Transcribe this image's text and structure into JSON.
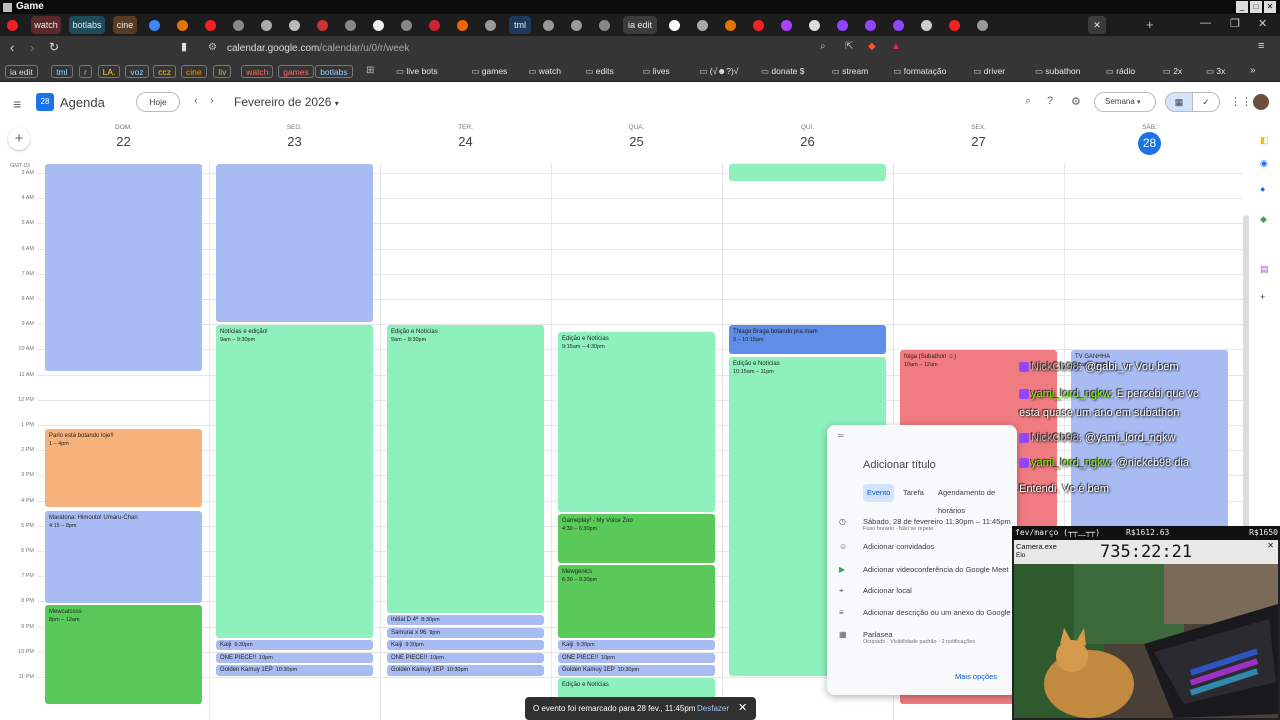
{
  "window": {
    "title": "Game"
  },
  "tabs": [
    {
      "type": "icon",
      "icon": "youtube-icon",
      "color": "#e22"
    },
    {
      "type": "label",
      "label": "watch",
      "bg": "#5a2a2a"
    },
    {
      "type": "label",
      "label": "botlabs",
      "bg": "#1e4c5a"
    },
    {
      "type": "label",
      "label": "cine",
      "bg": "#5a3a20"
    },
    {
      "type": "icon",
      "icon": "google-icon",
      "color": "#4285f4"
    },
    {
      "type": "icon",
      "icon": "extension-icon",
      "color": "#e37400"
    },
    {
      "type": "icon",
      "icon": "record-icon",
      "color": "#e22"
    },
    {
      "type": "icon",
      "icon": "page-icon",
      "color": "#888"
    },
    {
      "type": "icon",
      "icon": "globe-icon",
      "color": "#aaa"
    },
    {
      "type": "icon",
      "icon": "info-icon",
      "color": "#bbb"
    },
    {
      "type": "icon",
      "icon": "site-icon",
      "color": "#c33"
    },
    {
      "type": "icon",
      "icon": "site-icon",
      "color": "#888"
    },
    {
      "type": "icon",
      "icon": "site-icon",
      "color": "#eee"
    },
    {
      "type": "icon",
      "icon": "play-icon",
      "color": "#888"
    },
    {
      "type": "icon",
      "icon": "site-icon",
      "color": "#c23"
    },
    {
      "type": "icon",
      "icon": "site-icon",
      "color": "#e60"
    },
    {
      "type": "icon",
      "icon": "shield-icon",
      "color": "#999"
    },
    {
      "type": "label",
      "label": "tml",
      "bg": "#1e3a5a"
    },
    {
      "type": "icon",
      "icon": "shield-icon",
      "color": "#999"
    },
    {
      "type": "icon",
      "icon": "shield-icon",
      "color": "#999"
    },
    {
      "type": "icon",
      "icon": "site-icon",
      "color": "#888"
    },
    {
      "type": "label",
      "label": "ia edit",
      "bg": "#3c3c3c"
    },
    {
      "type": "icon",
      "icon": "stack-icon",
      "color": "#fff"
    },
    {
      "type": "icon",
      "icon": "site-icon",
      "color": "#aaa"
    },
    {
      "type": "icon",
      "icon": "site-icon",
      "color": "#e37400"
    },
    {
      "type": "icon",
      "icon": "youtube-icon",
      "color": "#e22"
    },
    {
      "type": "icon",
      "icon": "site-icon",
      "color": "#a4f"
    },
    {
      "type": "icon",
      "icon": "site-icon",
      "color": "#ddd"
    },
    {
      "type": "icon",
      "icon": "twitch-icon",
      "color": "#9147ff"
    },
    {
      "type": "icon",
      "icon": "twitch-icon",
      "color": "#9147ff"
    },
    {
      "type": "icon",
      "icon": "twitch-icon",
      "color": "#9147ff"
    },
    {
      "type": "icon",
      "icon": "site-icon",
      "color": "#ccc"
    },
    {
      "type": "icon",
      "icon": "youtube-icon",
      "color": "#e22"
    },
    {
      "type": "icon",
      "icon": "shield-icon",
      "color": "#999"
    }
  ],
  "address": {
    "domain": "calendar.google.com",
    "path": "/calendar/u/0/r/week"
  },
  "bookmarks": [
    {
      "label": "ia edit",
      "style": "pill",
      "color": "#ddd"
    },
    {
      "label": "tml",
      "style": "pill",
      "color": "#9cf"
    },
    {
      "label": "r",
      "style": "pill",
      "color": "#9c6"
    },
    {
      "label": "LA.",
      "style": "pill",
      "color": "#fc3"
    },
    {
      "label": "voz",
      "style": "pill",
      "color": "#9cf"
    },
    {
      "label": "ccz",
      "style": "pill",
      "color": "#fc3"
    },
    {
      "label": "cine",
      "style": "pill",
      "color": "#e90"
    },
    {
      "label": "liv",
      "style": "pill",
      "color": "#9c6"
    },
    {
      "label": "watch",
      "style": "pill",
      "color": "#f66"
    },
    {
      "label": "games",
      "style": "pill",
      "color": "#f66"
    },
    {
      "label": "botlabs",
      "style": "pill",
      "color": "#9cf"
    },
    {
      "label": "live bots",
      "style": "plain",
      "color": "#e8e8e8"
    },
    {
      "label": "games",
      "style": "plain",
      "color": "#e8e8e8"
    },
    {
      "label": "watch",
      "style": "plain",
      "color": "#e8e8e8"
    },
    {
      "label": "edits",
      "style": "plain",
      "color": "#e8e8e8"
    },
    {
      "label": "lives",
      "style": "plain",
      "color": "#e8e8e8"
    },
    {
      "label": "(√☻?)√",
      "style": "plain",
      "color": "#e8e8e8"
    },
    {
      "label": "donate $",
      "style": "plain",
      "color": "#e8e8e8"
    },
    {
      "label": "stream",
      "style": "plain",
      "color": "#e8e8e8"
    },
    {
      "label": "formatação",
      "style": "plain",
      "color": "#e8e8e8"
    },
    {
      "label": "driver",
      "style": "plain",
      "color": "#e8e8e8"
    },
    {
      "label": "subathon",
      "style": "plain",
      "color": "#e8e8e8"
    },
    {
      "label": "rádio",
      "style": "plain",
      "color": "#e8e8e8"
    },
    {
      "label": "2x",
      "style": "plain",
      "color": "#e8e8e8"
    },
    {
      "label": "3x",
      "style": "plain",
      "color": "#e8e8e8"
    }
  ],
  "calendar": {
    "app_name": "Agenda",
    "logo_day": "28",
    "today_label": "Hoje",
    "month_label": "Fevereiro de 2026",
    "view_label": "Semana",
    "timezone": "GMT-03",
    "days": [
      {
        "name": "DOM.",
        "date": "22",
        "today": false
      },
      {
        "name": "SEG.",
        "date": "23",
        "today": false
      },
      {
        "name": "TER.",
        "date": "24",
        "today": false
      },
      {
        "name": "QUA.",
        "date": "25",
        "today": false
      },
      {
        "name": "QUI.",
        "date": "26",
        "today": false
      },
      {
        "name": "SEX.",
        "date": "27",
        "today": false
      },
      {
        "name": "SÁB.",
        "date": "28",
        "today": true
      }
    ],
    "hours": [
      "3 AM",
      "4 AM",
      "5 AM",
      "6 AM",
      "7 AM",
      "8 AM",
      "9 AM",
      "10 AM",
      "11 AM",
      "12 PM",
      "1 PM",
      "2 PM",
      "3 PM",
      "4 PM",
      "5 PM",
      "6 PM",
      "7 PM",
      "8 PM",
      "9 PM",
      "10 PM",
      "11 PM"
    ],
    "events": [
      {
        "day": 0,
        "start": 2.6,
        "end": 10.9,
        "title": "",
        "time": "",
        "color": "#a8bbf2"
      },
      {
        "day": 0,
        "start": 13.1,
        "end": 16.3,
        "title": "Parlo está botando loje!!",
        "time": "1 – 4pm",
        "color": "#f6b27a"
      },
      {
        "day": 0,
        "start": 16.35,
        "end": 20.1,
        "title": "Maratona: Himouto! Umaru-Chan",
        "time": "4:15 – 8pm",
        "color": "#a8bbf2"
      },
      {
        "day": 0,
        "start": 20.1,
        "end": 24.1,
        "title": "Mewcatssss",
        "time": "8pm – 12am",
        "color": "#59c95a"
      },
      {
        "day": 1,
        "start": 2.6,
        "end": 8.95,
        "title": "",
        "time": "",
        "color": "#a8bbf2"
      },
      {
        "day": 1,
        "start": 9.0,
        "end": 21.5,
        "title": "Notícias e edição!",
        "time": "9am – 9:30pm",
        "color": "#8ef0bd"
      },
      {
        "day": 1,
        "start": 21.5,
        "end": 21.97,
        "title": "Kaiji",
        "time": "9:30pm",
        "color": "#a8bbf2"
      },
      {
        "day": 1,
        "start": 22.0,
        "end": 22.47,
        "title": "ONE PIECE!!",
        "time": "10pm",
        "color": "#a8bbf2"
      },
      {
        "day": 1,
        "start": 22.5,
        "end": 23.0,
        "title": "Golden Kamuy 1EP",
        "time": "10:30pm",
        "color": "#a8bbf2"
      },
      {
        "day": 2,
        "start": 9.0,
        "end": 20.5,
        "title": "Edição e Notícias",
        "time": "9am – 8:30pm",
        "color": "#8ef0bd"
      },
      {
        "day": 2,
        "start": 20.5,
        "end": 20.97,
        "title": "Initial D 4ª",
        "time": "8:30pm",
        "color": "#a8bbf2"
      },
      {
        "day": 2,
        "start": 21.0,
        "end": 21.47,
        "title": "Samurai x 96",
        "time": "9pm",
        "color": "#a8bbf2"
      },
      {
        "day": 2,
        "start": 21.5,
        "end": 21.97,
        "title": "Kaiji",
        "time": "9:30pm",
        "color": "#a8bbf2"
      },
      {
        "day": 2,
        "start": 22.0,
        "end": 22.47,
        "title": "ONE PIECE!!",
        "time": "10pm",
        "color": "#a8bbf2"
      },
      {
        "day": 2,
        "start": 22.5,
        "end": 23.0,
        "title": "Golden Kamuy 1EP",
        "time": "10:30pm",
        "color": "#a8bbf2"
      },
      {
        "day": 3,
        "start": 9.25,
        "end": 16.5,
        "title": "Edição e Notícias",
        "time": "9:15am – 4:30pm",
        "color": "#8ef0bd"
      },
      {
        "day": 3,
        "start": 16.5,
        "end": 18.5,
        "title": "Gameplay! - My Voice Zoo",
        "time": "4:30 – 6:30pm",
        "color": "#59c95a"
      },
      {
        "day": 3,
        "start": 18.5,
        "end": 21.5,
        "title": "Mewgenics",
        "time": "6:30 – 9:30pm",
        "color": "#59c95a"
      },
      {
        "day": 3,
        "start": 21.5,
        "end": 21.97,
        "title": "Kaiji",
        "time": "9:30pm",
        "color": "#a8bbf2"
      },
      {
        "day": 3,
        "start": 22.0,
        "end": 22.47,
        "title": "ONE PIECE!!",
        "time": "10pm",
        "color": "#a8bbf2"
      },
      {
        "day": 3,
        "start": 22.5,
        "end": 23.0,
        "title": "Golden Kamuy 1EP",
        "time": "10:30pm",
        "color": "#a8bbf2"
      },
      {
        "day": 3,
        "start": 23.0,
        "end": 24.1,
        "title": "Edição e Notícias",
        "time": "",
        "color": "#8ef0bd"
      },
      {
        "day": 4,
        "start": 2.6,
        "end": 3.35,
        "title": "",
        "time": "",
        "color": "#8ef0bd"
      },
      {
        "day": 4,
        "start": 9.0,
        "end": 10.2,
        "title": "Thiago Braga botando pra mam",
        "time": "9 – 10:15am",
        "color": "#5f8de8"
      },
      {
        "day": 4,
        "start": 10.25,
        "end": 23.0,
        "title": "Edição e Notícias",
        "time": "10:15am – 11pm",
        "color": "#8ef0bd"
      },
      {
        "day": 5,
        "start": 10.0,
        "end": 24.1,
        "title": "folga (Subathon ☺)",
        "time": "10am – 12am",
        "color": "#f07b80"
      },
      {
        "day": 6,
        "start": 10.0,
        "end": 24.1,
        "title": "TV GANHHA",
        "time": "10am – 7:30",
        "color": "#a8bbf2"
      }
    ]
  },
  "popup": {
    "title_placeholder": "Adicionar título",
    "tabs": [
      "Evento",
      "Tarefa",
      "Agendamento de horários"
    ],
    "rows": [
      {
        "icon": "clock-icon",
        "text": "Sábado, 28 de fevereiro    11:30pm  –  11:45pm",
        "sub": "Fuso horário · Não se repete"
      },
      {
        "icon": "people-icon",
        "text": "Adicionar convidados",
        "sub": ""
      },
      {
        "icon": "meet-icon",
        "text": "Adicionar videoconferência do Google Meet",
        "sub": ""
      },
      {
        "icon": "location-icon",
        "text": "Adicionar local",
        "sub": ""
      },
      {
        "icon": "notes-icon",
        "text": "Adicionar descrição ou um anexo do Google Drive",
        "sub": ""
      },
      {
        "icon": "calendar-icon",
        "text": "Parlasea",
        "sub": "Ocupado · Visibilidade padrão · 2 notificações"
      }
    ],
    "more_options": "Mais opções"
  },
  "toast": {
    "text": "O evento foi remarcado para 28 fev., 11:45pm",
    "undo": "Desfazer"
  },
  "chat": [
    {
      "user": "NickCb98",
      "msg": ": @gabi_vr Vou bem",
      "gray": true
    },
    {
      "user": "yami_lord_ngkw",
      "msg": ": E percebi que vc",
      "gray": false
    },
    {
      "user": "",
      "msg": "esta quase um ano em subathon",
      "gray": false
    },
    {
      "user": "NickCb98",
      "msg": ": @yami_lord_ngkw",
      "gray": true
    },
    {
      "user": "yami_lord_ngkw",
      "msg": ": @nickcb98 dia",
      "gray": false
    },
    {
      "user": "",
      "msg": "Entendi. Vc é bem",
      "gray": false
    }
  ],
  "stream_overlay": {
    "goal_label": "fev/março (┬┬﹏┬┬)",
    "amount": "R$1612.63",
    "amount_right": "R$1650",
    "app_title": "Camera.exe",
    "app_sub": "Elo",
    "timer": "735:22:21"
  }
}
